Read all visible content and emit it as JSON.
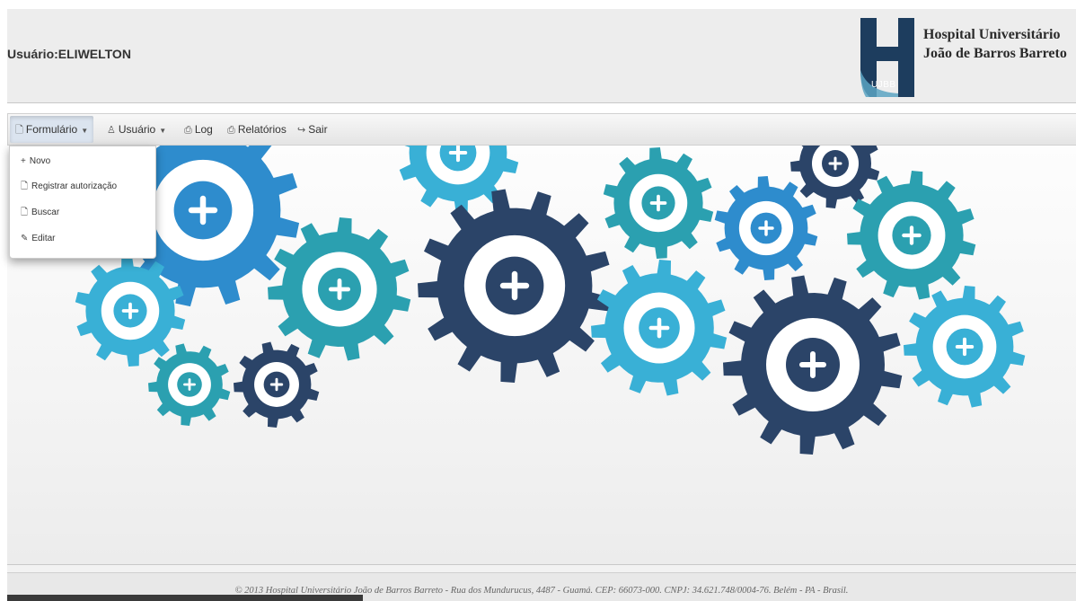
{
  "header": {
    "user_label": "Usuário:ELIWELTON",
    "logo": {
      "name_line1": "Hospital Universitário",
      "name_line2": "João de Barros Barreto",
      "abbr": "UJBB",
      "colors": [
        "#1d3d5e",
        "#5aa3c2"
      ]
    }
  },
  "navbar": {
    "items": [
      {
        "label": "Formulário",
        "icon": "document-icon",
        "has_caret": true,
        "active": true
      },
      {
        "label": "Usuário",
        "icon": "user-icon",
        "has_caret": true,
        "active": false
      },
      {
        "label": "Log",
        "icon": "clipboard-icon",
        "has_caret": false,
        "active": false
      },
      {
        "label": "Relatórios",
        "icon": "clipboard-icon",
        "has_caret": false,
        "active": false
      },
      {
        "label": "Sair",
        "icon": "share-icon",
        "has_caret": false,
        "active": false
      }
    ]
  },
  "dropdown": {
    "items": [
      {
        "label": "Novo",
        "icon": "plus-icon"
      },
      {
        "label": "Registrar autorização",
        "icon": "document-icon"
      },
      {
        "label": "Buscar",
        "icon": "document-icon"
      },
      {
        "label": "Editar",
        "icon": "pencil-icon"
      }
    ]
  },
  "banner": {
    "colors": {
      "dark": "#2b4468",
      "blue": "#2e8ccd",
      "teal": "#2ba0b0",
      "light": "#39b0d6"
    },
    "icons": [
      "ambulance-icon",
      "heart-icon",
      "microscope-icon",
      "syringe-icon",
      "stethoscope-icon",
      "caduceus-icon",
      "tooth-icon",
      "clipboard-edit-icon",
      "medical-bag-icon",
      "flask-icon",
      "pills-icon",
      "wheelchair-icon",
      "nurse-icon",
      "weight-icon"
    ]
  },
  "footer": {
    "text": "© 2013 Hospital Universitário João de Barros Barreto - Rua dos Mundurucus, 4487 - Guamá. CEP: 66073-000. CNPJ: 34.621.748/0004-76. Belém - PA - Brasil."
  }
}
